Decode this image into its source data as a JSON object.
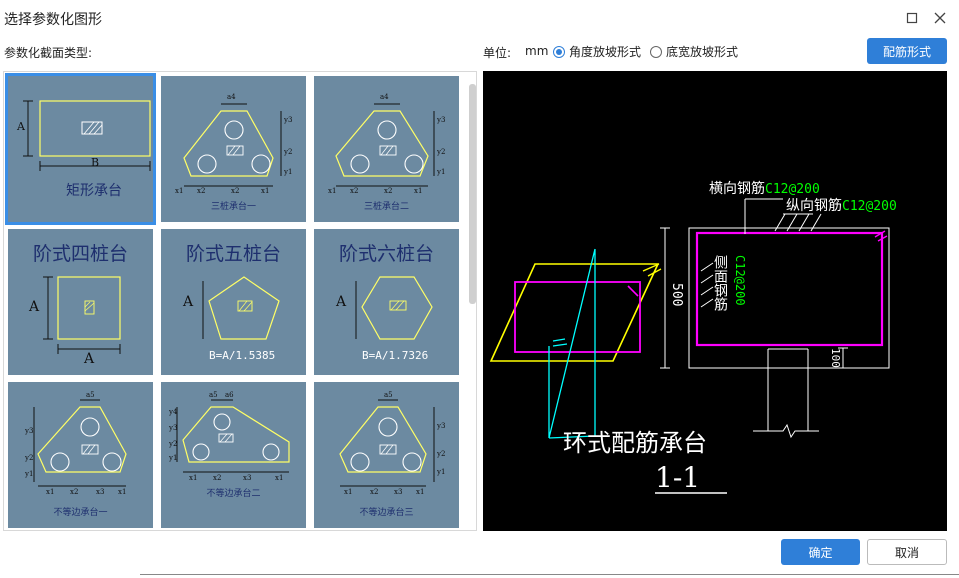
{
  "window": {
    "title": "选择参数化图形"
  },
  "toolbar": {
    "section_label": "参数化截面类型:",
    "unit_label": "单位:",
    "unit_value": "mm",
    "radio_angle": "角度放坡形式",
    "radio_width": "底宽放坡形式",
    "selected_radio": "angle",
    "rebar_button": "配筋形式"
  },
  "gallery": {
    "tiles": [
      {
        "label": "矩形承台",
        "dims": [
          "A",
          "B"
        ]
      },
      {
        "label": "三桩承台一",
        "dims": [
          "a4",
          "y3",
          "y2",
          "y1",
          "x1",
          "x2",
          "x2",
          "x1"
        ]
      },
      {
        "label": "三桩承台二",
        "dims": [
          "a4",
          "y3",
          "y2",
          "y1",
          "x1",
          "x2",
          "x2",
          "x1"
        ]
      },
      {
        "label": "阶式四桩台",
        "dims": [
          "A",
          "A"
        ]
      },
      {
        "label": "阶式五桩台",
        "dims": [
          "A"
        ],
        "ratio": "B=A/1.5385"
      },
      {
        "label": "阶式六桩台",
        "dims": [
          "A"
        ],
        "ratio": "B=A/1.7326"
      },
      {
        "label": "不等边承台一",
        "dims": [
          "a5",
          "y3",
          "y2",
          "y1",
          "x1",
          "x2",
          "x3",
          "x1"
        ]
      },
      {
        "label": "不等边承台二",
        "dims": [
          "a5",
          "a6",
          "y4",
          "y3",
          "y2",
          "y1",
          "x1",
          "x2",
          "x3",
          "x1"
        ]
      },
      {
        "label": "不等边承台三",
        "dims": [
          "a5",
          "y3",
          "y2",
          "y1",
          "x1",
          "x2",
          "x3",
          "x1"
        ]
      }
    ]
  },
  "preview": {
    "title": "环式配筋承台",
    "section": "1-1",
    "horizontal_rebar": "横向钢筋",
    "horizontal_spec": "C12@200",
    "longitudinal_rebar": "纵向钢筋",
    "longitudinal_spec": "C12@200",
    "side_rebar": "侧面钢筋",
    "side_spec": "C12@200",
    "height_dim": "500",
    "bottom_dim": "100"
  },
  "footer": {
    "ok": "确定",
    "cancel": "取消"
  },
  "colors": {
    "accent": "#2f7fd8",
    "tile_bg": "#6c8aa1",
    "cad_bg": "#000000",
    "cad_magenta": "#ff00ff",
    "cad_green": "#00ff00",
    "cad_yellow": "#ffff00",
    "cad_cyan": "#00ffff"
  }
}
